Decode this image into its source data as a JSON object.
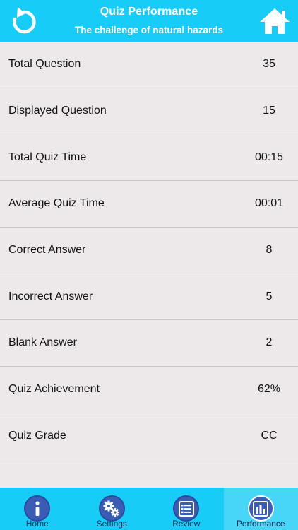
{
  "header": {
    "title": "Quiz Performance",
    "subtitle": "The challenge of natural hazards",
    "back_icon": "undo-arrow-icon",
    "home_icon": "home-icon"
  },
  "stats": [
    {
      "label": "Total Question",
      "value": "35"
    },
    {
      "label": "Displayed Question",
      "value": "15"
    },
    {
      "label": "Total Quiz Time",
      "value": "00:15"
    },
    {
      "label": "Average Quiz Time",
      "value": "00:01"
    },
    {
      "label": "Correct Answer",
      "value": "8"
    },
    {
      "label": "Incorrect Answer",
      "value": "5"
    },
    {
      "label": "Blank Answer",
      "value": "2"
    },
    {
      "label": "Quiz Achievement",
      "value": "62%"
    },
    {
      "label": "Quiz Grade",
      "value": "CC"
    }
  ],
  "tabs": [
    {
      "label": "Home",
      "icon": "info-icon"
    },
    {
      "label": "Settings",
      "icon": "gears-icon"
    },
    {
      "label": "Review",
      "icon": "list-icon"
    },
    {
      "label": "Performance",
      "icon": "bar-chart-icon",
      "active": true
    }
  ],
  "colors": {
    "accent": "#17cdf7",
    "background": "#ede8e9",
    "tab_icon": "#3b5cb5"
  }
}
